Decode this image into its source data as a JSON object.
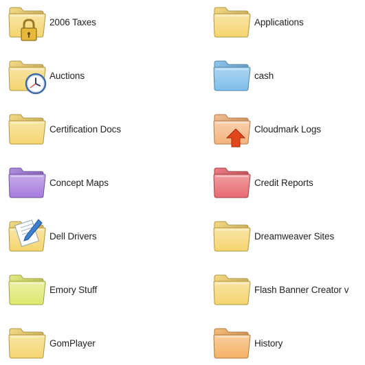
{
  "folders": [
    {
      "name": "2006 Taxes",
      "color": "#f2cf5b",
      "badge": "lock-icon"
    },
    {
      "name": "Applications",
      "color": "#f2cf5b",
      "badge": ""
    },
    {
      "name": "Auctions",
      "color": "#f2cf5b",
      "badge": "clock-icon"
    },
    {
      "name": "cash",
      "color": "#6cb4e8",
      "badge": ""
    },
    {
      "name": "Certification Docs",
      "color": "#f2cf5b",
      "badge": ""
    },
    {
      "name": "Cloudmark Logs",
      "color": "#f3a96a",
      "badge": "arrow-up-icon"
    },
    {
      "name": "Concept Maps",
      "color": "#9a69d8",
      "badge": ""
    },
    {
      "name": "Credit Reports",
      "color": "#e5545c",
      "badge": ""
    },
    {
      "name": "Dell Drivers",
      "color": "#f2cf5b",
      "badge": "document-pen-icon"
    },
    {
      "name": "Dreamweaver Sites",
      "color": "#f2cf5b",
      "badge": ""
    },
    {
      "name": "Emory Stuff",
      "color": "#d9e45a",
      "badge": ""
    },
    {
      "name": "Flash Banner Creator v",
      "color": "#f2cf5b",
      "badge": ""
    },
    {
      "name": "GomPlayer",
      "color": "#f2cf5b",
      "badge": ""
    },
    {
      "name": "History",
      "color": "#f4a852",
      "badge": ""
    }
  ]
}
